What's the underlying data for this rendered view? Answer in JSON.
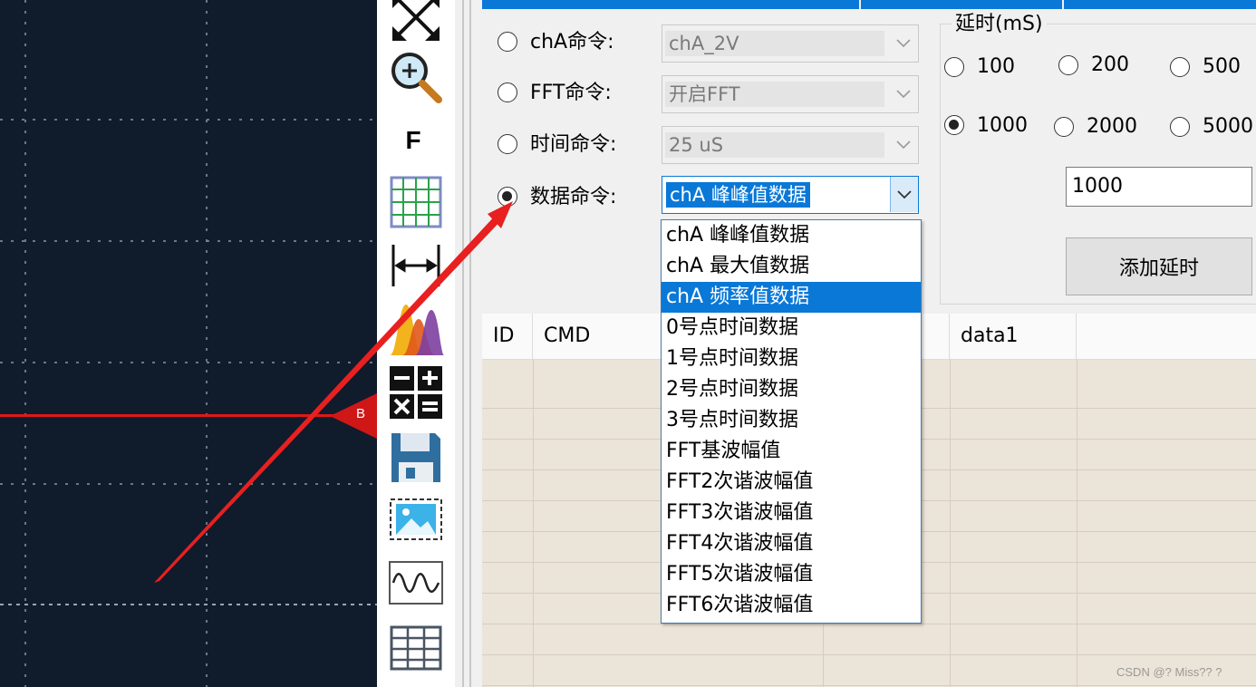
{
  "colors": {
    "accent": "#0a78d7",
    "scope_bg": "#101b2c",
    "trace": "#e01818",
    "grid_bg": "#ebe4d8"
  },
  "toolbar": {
    "icons": [
      "fit-window-icon",
      "zoom-icon",
      "f-icon",
      "grid-icon",
      "measure-width-icon",
      "spectrum-icon",
      "calculator-icon",
      "save-icon",
      "picture-icon",
      "waveform-icon",
      "table-icon"
    ],
    "f_text": "F"
  },
  "marker": {
    "label": "B"
  },
  "commands": {
    "rows": [
      {
        "label": "chA命令:",
        "value": "chA_2V",
        "checked": false
      },
      {
        "label": "FFT命令:",
        "value": "开启FFT",
        "checked": false
      },
      {
        "label": "时间命令:",
        "value": "25 uS",
        "checked": false
      },
      {
        "label": "数据命令:",
        "value": "chA 峰峰值数据",
        "checked": true
      }
    ]
  },
  "dropdown": {
    "items": [
      "chA 峰峰值数据",
      "chA 最大值数据",
      "chA 频率值数据",
      "0号点时间数据",
      "1号点时间数据",
      "2号点时间数据",
      "3号点时间数据",
      "FFT基波幅值",
      "FFT2次谐波幅值",
      "FFT3次谐波幅值",
      "FFT4次谐波幅值",
      "FFT5次谐波幅值",
      "FFT6次谐波幅值"
    ],
    "highlighted_index": 2
  },
  "delay": {
    "title": "延时(mS)",
    "options": [
      "100",
      "200",
      "500",
      "1000",
      "2000",
      "5000"
    ],
    "selected": "1000",
    "input_value": "1000",
    "add_button": "添加延时"
  },
  "table": {
    "columns": [
      "ID",
      "CMD",
      "",
      "data1",
      ""
    ]
  },
  "watermark": "CSDN @? Miss?? ?"
}
